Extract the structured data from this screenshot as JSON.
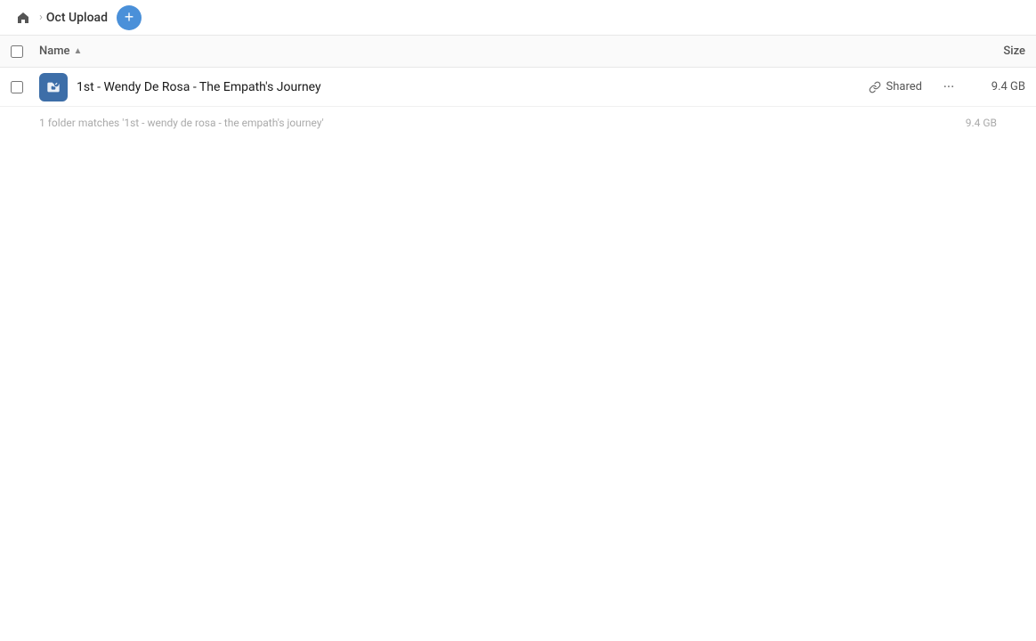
{
  "header": {
    "home_icon": "home-icon",
    "breadcrumb_chevron": "›",
    "folder_name": "Oct Upload",
    "add_button_label": "+"
  },
  "columns": {
    "name_label": "Name",
    "sort_arrow": "▲",
    "size_label": "Size"
  },
  "file_row": {
    "icon_type": "link-folder-icon",
    "file_name": "1st - Wendy De Rosa - The Empath's Journey",
    "shared_label": "Shared",
    "more_icon": "•••",
    "file_size": "9.4 GB"
  },
  "summary": {
    "text": "1 folder matches '1st - wendy de rosa - the empath's journey'",
    "size": "9.4 GB"
  }
}
